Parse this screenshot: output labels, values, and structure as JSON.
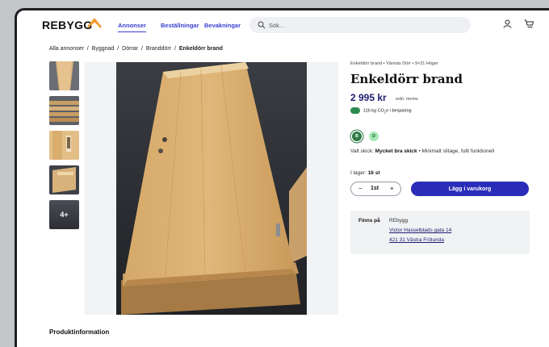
{
  "header": {
    "logo": "REBYGG",
    "nav": [
      "Annonser",
      "Beställningar",
      "Bevakningar"
    ],
    "search_placeholder": "Sök..."
  },
  "breadcrumb": {
    "items": [
      "Alla annonser",
      "Byggnad",
      "Dörrar",
      "Branddörr",
      "Enkeldörr brand"
    ],
    "current": "Enkeldörr brand",
    "separator": "/"
  },
  "thumbnails": {
    "more_label": "4+"
  },
  "product": {
    "meta": "Enkeldörr brand • Vännäs Dörr • 9×21 Höger",
    "title": "Enkeldörr brand",
    "price": "2 995 kr",
    "price_note": "exkl. moms",
    "co2_prefix": "116 kg CO",
    "co2_sub": "2",
    "co2_suffix": "e i besparing",
    "grades": [
      "B",
      "D"
    ],
    "condition_label": "Valt skick:",
    "condition_value": "Mycket bra skick",
    "condition_desc": "• Minimalt slitage, fullt funktionell",
    "stock_label": "I lager:",
    "stock_value": "16 st",
    "qty_minus": "−",
    "qty_value": "1st",
    "qty_plus": "+",
    "cart_button": "Lägg i varukorg"
  },
  "availability": {
    "label": "Finns på",
    "store": "REbygg",
    "address_line1": "Victor Hasselblads gata 14",
    "address_line2": "421 31 Västra Frölunda"
  },
  "section_title": "Produktinformation",
  "colors": {
    "accent": "#2a2db8",
    "nav_blue": "#3b3fd0",
    "logo_orange": "#f29a2e",
    "grade_green": "#2f7a46"
  }
}
